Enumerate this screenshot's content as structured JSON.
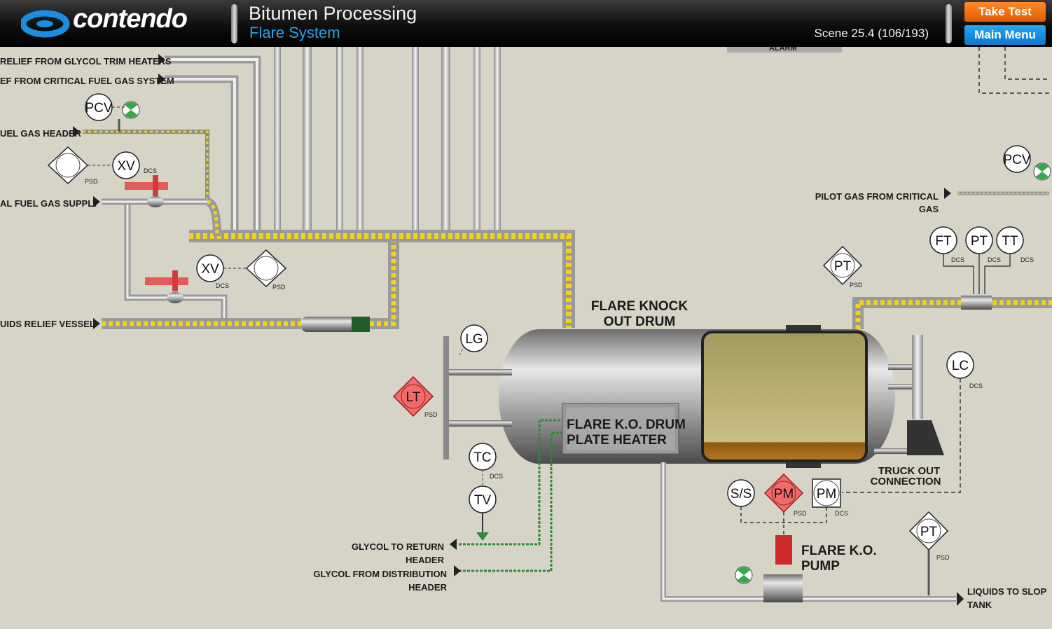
{
  "header": {
    "brand": "contendo",
    "title": "Bitumen Processing",
    "subtitle": "Flare System",
    "scene": "Scene 25.4 (106/193)",
    "take_test": "Take Test",
    "main_menu": "Main Menu"
  },
  "colors": {
    "background": "#d6d4c7",
    "pipe_highlight": "#f2d21c",
    "alarm_red": "#e35a5a",
    "accent_blue": "#2aa1e8",
    "button_orange": "#f47a1a"
  },
  "labels": {
    "relief_glycol": "RELIEF FROM GLYCOL TRIM HEATERS",
    "relief_critical": "EF FROM CRITICAL FUEL GAS SYSTEM",
    "fuel_gas_header": "UEL GAS HEADER",
    "fuel_gas_supply": "AL FUEL GAS SUPPLY",
    "liquids_relief": "UIDS RELIEF VESSEL",
    "alarm": "ALARM",
    "knock_out_1": "FLARE KNOCK",
    "knock_out_2": "OUT DRUM",
    "plate_heater_1": "FLARE K.O. DRUM",
    "plate_heater_2": "PLATE HEATER",
    "pilot_gas_1": "PILOT GAS FROM CRITICAL",
    "pilot_gas_2": "GAS",
    "truck_out_1": "TRUCK OUT",
    "truck_out_2": "CONNECTION",
    "pump_1": "FLARE K.O.",
    "pump_2": "PUMP",
    "glycol_return_1": "GLYCOL TO RETURN",
    "glycol_return_2": "HEADER",
    "glycol_from_1": "GLYCOL FROM DISTRIBUTION",
    "glycol_from_2": "HEADER",
    "slop_1": "LIQUIDS TO SLOP",
    "slop_2": "TANK"
  },
  "instruments": {
    "pcv_left": "PCV",
    "xv_top": "XV",
    "xv_bottom": "XV",
    "lg": "LG",
    "lt": "LT",
    "tc": "TC",
    "tv": "TV",
    "pt_mid": "PT",
    "ft": "FT",
    "pt_right": "PT",
    "tt": "TT",
    "pcv_right": "PCV",
    "lc": "LC",
    "ss": "S/S",
    "pm_alarm": "PM",
    "pm_dcs": "PM",
    "pt_slop": "PT"
  },
  "sublabels": {
    "psd": "PSD",
    "dcs": "DCS"
  }
}
